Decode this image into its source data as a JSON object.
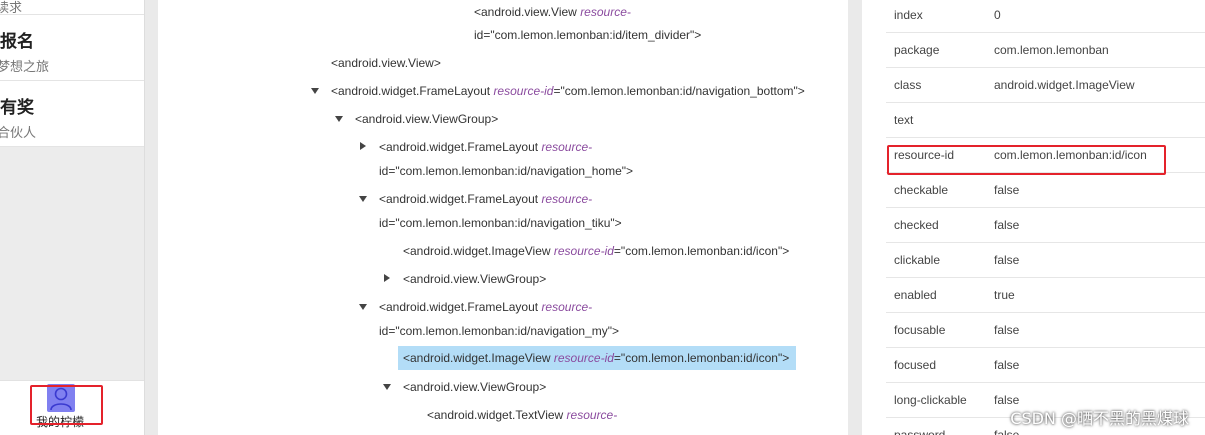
{
  "device": {
    "cards": [
      {
        "title": "",
        "subtitle": "读求"
      },
      {
        "title": "报名",
        "subtitle": "梦想之旅"
      },
      {
        "title": "有奖",
        "subtitle": "合伙人"
      }
    ],
    "nav_my_label": "我的柠檬"
  },
  "tree": {
    "nodes": [
      {
        "line1_tag": "<android.view.View",
        "line1_attr": "resource-",
        "line2": "id=\"com.lemon.lemonban:id/item_divider\">"
      },
      {
        "tag": "<android.view.View>"
      },
      {
        "tag": "<android.widget.FrameLayout",
        "attr": "resource-id",
        "val": "=\"com.lemon.lemonban:id/navigation_bottom\">"
      },
      {
        "tag": "<android.view.ViewGroup>"
      },
      {
        "line1_tag": "<android.widget.FrameLayout",
        "line1_attr": "resource-",
        "line2": "id=\"com.lemon.lemonban:id/navigation_home\">"
      },
      {
        "line1_tag": "<android.widget.FrameLayout",
        "line1_attr": "resource-",
        "line2": "id=\"com.lemon.lemonban:id/navigation_tiku\">"
      },
      {
        "tag": "<android.widget.ImageView",
        "attr": "resource-id",
        "val": "=\"com.lemon.lemonban:id/icon\">"
      },
      {
        "tag": "<android.view.ViewGroup>"
      },
      {
        "line1_tag": "<android.widget.FrameLayout",
        "line1_attr": "resource-",
        "line2": "id=\"com.lemon.lemonban:id/navigation_my\">"
      },
      {
        "tag": "<android.widget.ImageView",
        "attr": "resource-id",
        "val": "=\"com.lemon.lemonban:id/icon\">"
      },
      {
        "tag": "<android.view.ViewGroup>"
      },
      {
        "line1_tag": "<android.widget.TextView",
        "line1_attr": "resource-"
      }
    ]
  },
  "properties": [
    {
      "key": "index",
      "value": "0"
    },
    {
      "key": "package",
      "value": "com.lemon.lemonban"
    },
    {
      "key": "class",
      "value": "android.widget.ImageView"
    },
    {
      "key": "text",
      "value": ""
    },
    {
      "key": "resource-id",
      "value": "com.lemon.lemonban:id/icon"
    },
    {
      "key": "checkable",
      "value": "false"
    },
    {
      "key": "checked",
      "value": "false"
    },
    {
      "key": "clickable",
      "value": "false"
    },
    {
      "key": "enabled",
      "value": "true"
    },
    {
      "key": "focusable",
      "value": "false"
    },
    {
      "key": "focused",
      "value": "false"
    },
    {
      "key": "long-clickable",
      "value": "false"
    },
    {
      "key": "password",
      "value": "false"
    }
  ],
  "watermark": "CSDN @晒不黑的黑煤球",
  "colors": {
    "highlight": "#b3ddf7",
    "annotation_red": "#e4222b",
    "avatar": "#8080f0"
  }
}
